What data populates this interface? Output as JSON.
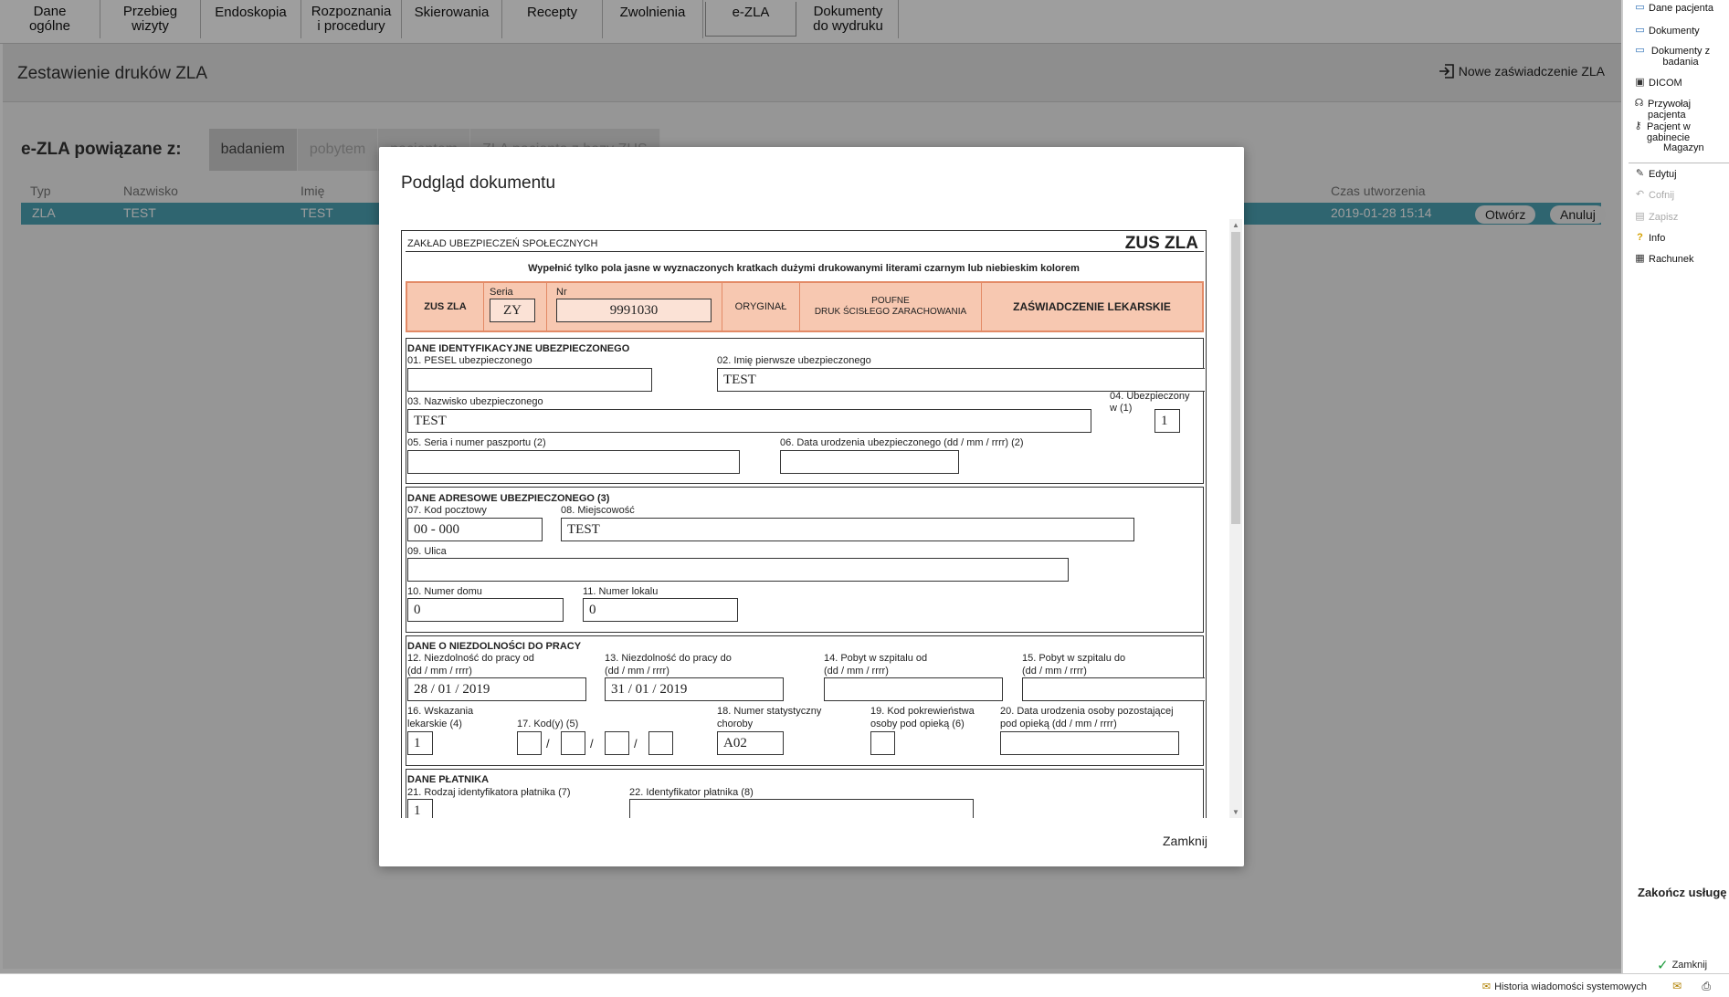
{
  "tabs": [
    {
      "label": "Dane\nogólne"
    },
    {
      "label": "Przebieg\nwizyty"
    },
    {
      "label": "Endoskopia"
    },
    {
      "label": "Rozpoznania\ni procedury"
    },
    {
      "label": "Skierowania"
    },
    {
      "label": "Recepty"
    },
    {
      "label": "Zwolnienia"
    },
    {
      "label": "e-ZLA"
    },
    {
      "label": "Dokumenty\ndo wydruku"
    }
  ],
  "main": {
    "title": "Zestawienie druków ZLA",
    "new_button": "Nowe zaświadczenie ZLA",
    "linked_label": "e-ZLA powiązane z:",
    "segments": [
      "badaniem",
      "pobytem",
      "pacjentem",
      "ZLA pacjenta z bazy ZUS"
    ],
    "columns": [
      "Typ",
      "Nazwisko",
      "Imię",
      "Czas utworzenia"
    ],
    "row": {
      "typ": "ZLA",
      "nazwisko": "TEST",
      "imie": "TEST",
      "czas": "2019-01-28 15:14",
      "open": "Otwórz",
      "cancel": "Anuluj"
    }
  },
  "sidebar": {
    "items": [
      {
        "label": "Dane pacjenta"
      },
      {
        "label": "Dokumenty"
      },
      {
        "label": "Dokumenty z badania"
      },
      {
        "label": "DICOM"
      },
      {
        "label": "Przywołaj pacjenta"
      },
      {
        "label": "Pacjent w gabinecie"
      },
      {
        "label": "Magazyn"
      },
      {
        "label": "Edytuj"
      },
      {
        "label": "Cofnij"
      },
      {
        "label": "Zapisz"
      },
      {
        "label": "Info"
      },
      {
        "label": "Rachunek"
      }
    ],
    "finish": "Zakończ usługę",
    "close": "Zamknij"
  },
  "statusbar": {
    "history": "Historia wiadomości systemowych"
  },
  "modal": {
    "title": "Podgląd dokumentu",
    "close": "Zamknij"
  },
  "form": {
    "org": "ZAKŁAD UBEZPIECZEŃ SPOŁECZNYCH",
    "code": "ZUS ZLA",
    "instruction": "Wypełnić tylko pola jasne w wyznaczonych kratkach dużymi drukowanymi literami czarnym lub niebieskim kolorem",
    "band": {
      "zus": "ZUS ZLA",
      "seria_label": "Seria",
      "seria": "ZY",
      "nr_label": "Nr",
      "nr": "9991030",
      "orig": "ORYGINAŁ",
      "poufne": "POUFNE",
      "druk": "DRUK ŚCISŁEGO ZARACHOWANIA",
      "zasw": "ZAŚWIADCZENIE LEKARSKIE"
    },
    "sec1": {
      "title": "DANE IDENTYFIKACYJNE UBEZPIECZONEGO",
      "f01": "01. PESEL ubezpieczonego",
      "f02": "02. Imię pierwsze ubezpieczonego",
      "v02": "TEST",
      "f03": "03. Nazwisko ubezpieczonego",
      "v03": "TEST",
      "f04a": "04. Ubezpieczony",
      "f04b": "w (1)",
      "v04": "1",
      "f05": "05. Seria i numer paszportu (2)",
      "f06": "06. Data urodzenia ubezpieczonego (dd / mm / rrrr) (2)"
    },
    "sec2": {
      "title": "DANE ADRESOWE UBEZPIECZONEGO (3)",
      "f07": "07. Kod pocztowy",
      "v07": "00 - 000",
      "f08": "08. Miejscowość",
      "v08": "TEST",
      "f09": "09. Ulica",
      "f10": "10. Numer domu",
      "v10": "0",
      "f11": "11. Numer lokalu",
      "v11": "0"
    },
    "sec3": {
      "title": "DANE O NIEZDOLNOŚCI DO PRACY",
      "f12a": "12. Niezdolność do pracy od",
      "f12b": "(dd / mm / rrrr)",
      "v12": "28 / 01 / 2019",
      "f13a": "13. Niezdolność do pracy do",
      "f13b": "(dd / mm / rrrr)",
      "v13": "31 / 01 / 2019",
      "f14a": "14. Pobyt w szpitalu od",
      "f14b": "(dd / mm / rrrr)",
      "f15a": "15. Pobyt w szpitalu do",
      "f15b": "(dd / mm / rrrr)",
      "f16a": "16. Wskazania",
      "f16b": "lekarskie (4)",
      "v16": "1",
      "f17": "17. Kod(y) (5)",
      "slash": "/",
      "f18a": "18. Numer statystyczny",
      "f18b": "choroby",
      "v18": "A02",
      "f19a": "19. Kod pokrewieństwa",
      "f19b": "osoby pod opieką (6)",
      "f20a": "20. Data urodzenia osoby pozostającej",
      "f20b": "pod opieką (dd / mm / rrrr)"
    },
    "sec4": {
      "title": "DANE PŁATNIKA",
      "f21": "21. Rodzaj identyfikatora płatnika (7)",
      "v21": "1",
      "f22": "22. Identyfikator płatnika (8)"
    }
  }
}
